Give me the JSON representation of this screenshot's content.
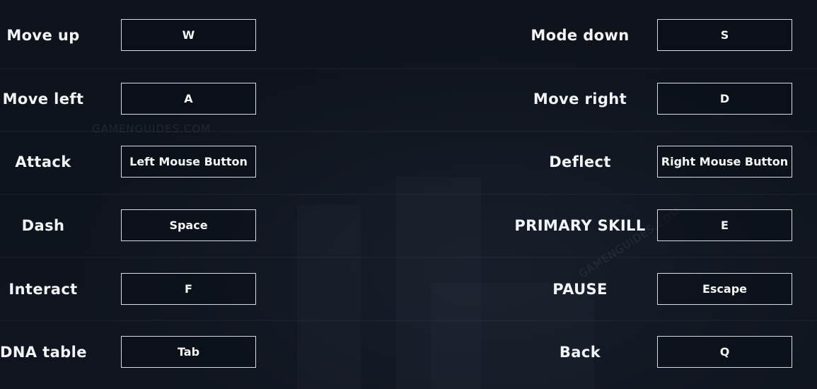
{
  "watermark": {
    "text": "GAMENGUIDES.COM"
  },
  "controls": {
    "left": [
      {
        "action": "Move up",
        "key": "W"
      },
      {
        "action": "Move left",
        "key": "A"
      },
      {
        "action": "Attack",
        "key": "Left Mouse Button"
      },
      {
        "action": "Dash",
        "key": "Space"
      },
      {
        "action": "Interact",
        "key": "F"
      },
      {
        "action": "DNA table",
        "key": "Tab"
      }
    ],
    "right": [
      {
        "action": "Mode down",
        "key": "S"
      },
      {
        "action": "Move right",
        "key": "D"
      },
      {
        "action": "Deflect",
        "key": "Right Mouse Button"
      },
      {
        "action": "PRIMARY SKILL",
        "key": "E"
      },
      {
        "action": "PAUSE",
        "key": "Escape"
      },
      {
        "action": "Back",
        "key": "Q"
      }
    ]
  }
}
